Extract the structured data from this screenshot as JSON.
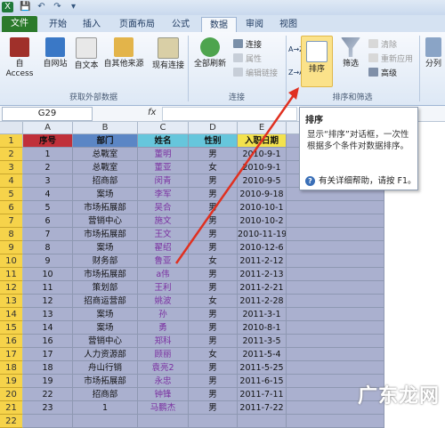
{
  "quick_access": {
    "file_char": "X",
    "save": "💾",
    "undo": "↶",
    "redo": "↷",
    "dropdown": "▾"
  },
  "tabs": [
    "文件",
    "开始",
    "插入",
    "页面布局",
    "公式",
    "数据",
    "审阅",
    "视图"
  ],
  "ribbon": {
    "get_external": {
      "access": "自 Access",
      "web": "自网站",
      "text": "自文本",
      "other": "自其他来源",
      "existing": "现有连接",
      "group_label": "获取外部数据"
    },
    "connections": {
      "refresh_all": "全部刷新",
      "connections": "连接",
      "properties": "属性",
      "edit_links": "编辑链接",
      "group_label": "连接"
    },
    "sort_filter": {
      "sort_asc": "A→Z",
      "sort_desc": "Z→A",
      "sort": "排序",
      "filter": "筛选",
      "clear": "清除",
      "reapply": "重新应用",
      "advanced": "高级",
      "group_label": "排序和筛选"
    },
    "outline": {
      "split": "分列"
    }
  },
  "formula_bar": {
    "name_box": "G29",
    "fx": "fx"
  },
  "columns": [
    "A",
    "B",
    "C",
    "D",
    "E",
    "F"
  ],
  "row_numbers": [
    "1",
    "2",
    "3",
    "4",
    "5",
    "6",
    "7",
    "8",
    "9",
    "10",
    "11",
    "12",
    "13",
    "14",
    "15",
    "16",
    "17",
    "18",
    "19",
    "20",
    "21",
    "22"
  ],
  "table": {
    "headers": [
      "序号",
      "部门",
      "姓名",
      "性别",
      "入职日期"
    ],
    "rows": [
      [
        "1",
        "总戰室",
        "董明",
        "男",
        "2010-9-1"
      ],
      [
        "2",
        "总戰室",
        "董亚",
        "女",
        "2010-9-1"
      ],
      [
        "3",
        "招商部",
        "闵青",
        "男",
        "2010-9-5"
      ],
      [
        "4",
        "案场",
        "李军",
        "男",
        "2010-9-18"
      ],
      [
        "5",
        "市场拓展部",
        "吴合",
        "男",
        "2010-10-1"
      ],
      [
        "6",
        "营销中心",
        "施文",
        "男",
        "2010-10-2"
      ],
      [
        "7",
        "市场拓展部",
        "王文",
        "男",
        "2010-11-19"
      ],
      [
        "8",
        "案场",
        "翟绍",
        "男",
        "2010-12-6"
      ],
      [
        "9",
        "财务部",
        "鲁亚",
        "女",
        "2011-2-12"
      ],
      [
        "10",
        "市场拓展部",
        "a伟",
        "男",
        "2011-2-13"
      ],
      [
        "11",
        "策划部",
        "王利",
        "男",
        "2011-2-21"
      ],
      [
        "12",
        "招商运营部",
        "姚波",
        "女",
        "2011-2-28"
      ],
      [
        "13",
        "案场",
        "孙",
        "男",
        "2011-3-1"
      ],
      [
        "14",
        "案场",
        "勇",
        "男",
        "2010-8-1"
      ],
      [
        "16",
        "营销中心",
        "郑科",
        "男",
        "2011-3-5"
      ],
      [
        "17",
        "人力资源部",
        "顾丽",
        "女",
        "2011-5-4"
      ],
      [
        "18",
        "舟山行销",
        "袁亮2",
        "男",
        "2011-5-25"
      ],
      [
        "19",
        "市场拓展部",
        "永忠",
        "男",
        "2011-6-15"
      ],
      [
        "22",
        "招商部",
        "钟锋",
        "男",
        "2011-7-11"
      ],
      [
        "23",
        "1",
        "马鹏杰",
        "男",
        "2011-7-22"
      ]
    ]
  },
  "tooltip": {
    "title": "排序",
    "body": "显示“排序”对话框，一次性根据多个条件对数据排序。",
    "help": "有关详细帮助，请按 F1。"
  },
  "watermark": "广东龙网",
  "colors": {
    "accent_tab": "#2b7a2b",
    "table_bg": "#aab0cf",
    "header_red": "#c0303a",
    "header_blue": "#5b86c5",
    "header_cyan": "#66c6dc",
    "header_yellow": "#f3e24d",
    "arrow": "#e03020"
  }
}
